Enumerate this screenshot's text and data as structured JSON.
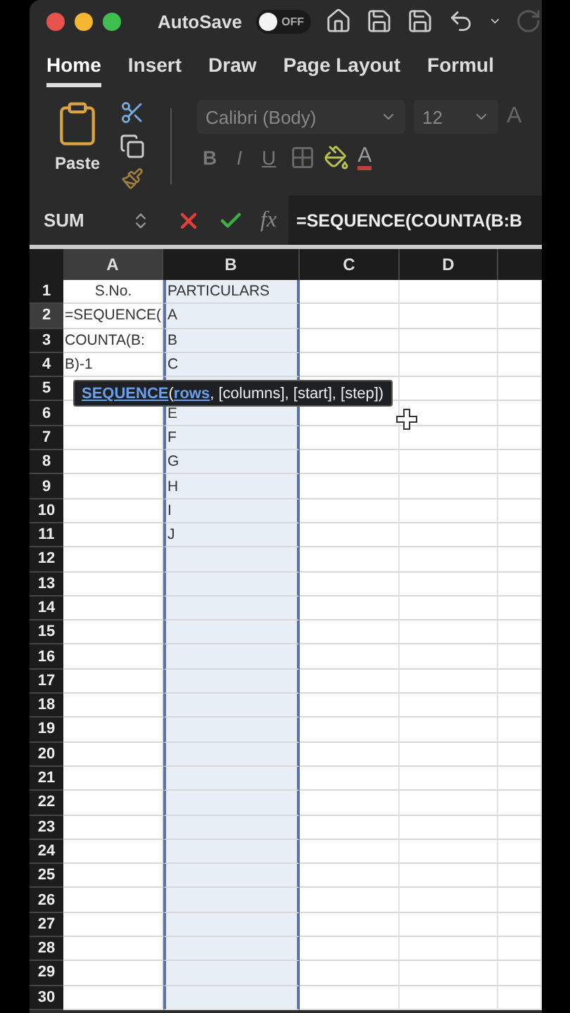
{
  "title_bar": {
    "autosave": {
      "label": "AutoSave",
      "on": false,
      "state_text": "OFF"
    }
  },
  "tabs": [
    {
      "label": "Home",
      "selected": true
    },
    {
      "label": "Insert",
      "selected": false
    },
    {
      "label": "Draw",
      "selected": false
    },
    {
      "label": "Page Layout",
      "selected": false
    },
    {
      "label": "Formul",
      "selected": false
    }
  ],
  "ribbon": {
    "paste_label": "Paste",
    "font": "Calibri (Body)",
    "size": "12",
    "grow_font": "A",
    "format_buttons": [
      "B",
      "I",
      "U"
    ],
    "font_color": "A"
  },
  "formula_bar": {
    "name_box": "SUM",
    "function_button": "fx",
    "formula": "=SEQUENCE(COUNTA(B:B"
  },
  "columns": [
    {
      "label": "A",
      "selected": true,
      "referenced": false
    },
    {
      "label": "B",
      "selected": false,
      "referenced": true
    },
    {
      "label": "C",
      "selected": false,
      "referenced": false
    },
    {
      "label": "D",
      "selected": false,
      "referenced": false
    }
  ],
  "rows": [
    {
      "number": "1",
      "selected": false,
      "a": "S.No.",
      "b": "PARTICULARS"
    },
    {
      "number": "2",
      "selected": true,
      "a": "=SEQUENCE(",
      "b": "A"
    },
    {
      "number": "3",
      "selected": false,
      "a": "COUNTA(B:",
      "b": "B"
    },
    {
      "number": "4",
      "selected": false,
      "a": "B)-1",
      "b": "C"
    },
    {
      "number": "5",
      "selected": false
    },
    {
      "number": "6",
      "selected": false,
      "b": "E"
    },
    {
      "number": "7",
      "selected": false,
      "b": "F"
    },
    {
      "number": "8",
      "selected": false,
      "b": "G"
    },
    {
      "number": "9",
      "selected": false,
      "b": "H"
    },
    {
      "number": "10",
      "selected": false,
      "b": "I"
    },
    {
      "number": "11",
      "selected": false,
      "b": "J"
    },
    {
      "number": "12",
      "selected": false
    },
    {
      "number": "13",
      "selected": false
    },
    {
      "number": "14",
      "selected": false
    },
    {
      "number": "15",
      "selected": false
    },
    {
      "number": "16",
      "selected": false
    },
    {
      "number": "17",
      "selected": false
    },
    {
      "number": "18",
      "selected": false
    },
    {
      "number": "19",
      "selected": false
    },
    {
      "number": "20",
      "selected": false
    },
    {
      "number": "21",
      "selected": false
    },
    {
      "number": "22",
      "selected": false
    },
    {
      "number": "23",
      "selected": false
    },
    {
      "number": "24",
      "selected": false
    },
    {
      "number": "25",
      "selected": false
    },
    {
      "number": "26",
      "selected": false
    },
    {
      "number": "27",
      "selected": false
    },
    {
      "number": "28",
      "selected": false
    },
    {
      "number": "29",
      "selected": false
    },
    {
      "number": "30",
      "selected": false
    }
  ],
  "tooltip": {
    "function": "SEQUENCE",
    "open": "(",
    "argument": "rows",
    "rest": ", [columns], [start], [step])"
  }
}
